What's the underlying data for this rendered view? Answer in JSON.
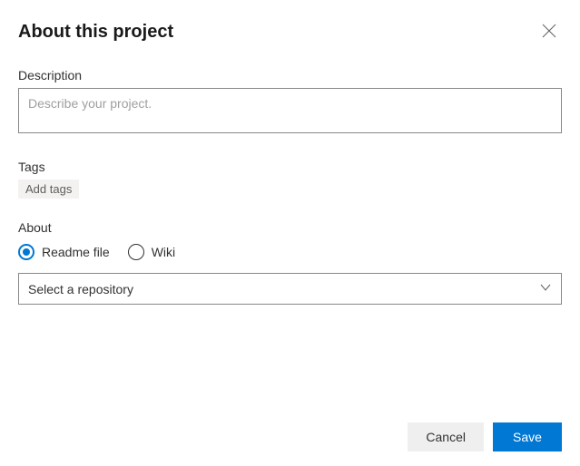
{
  "title": "About this project",
  "description": {
    "label": "Description",
    "placeholder": "Describe your project.",
    "value": ""
  },
  "tags": {
    "label": "Tags",
    "add_label": "Add tags"
  },
  "about": {
    "label": "About",
    "options": {
      "readme": {
        "label": "Readme file",
        "selected": true
      },
      "wiki": {
        "label": "Wiki",
        "selected": false
      }
    },
    "repository_select": {
      "placeholder": "Select a repository"
    }
  },
  "buttons": {
    "cancel": "Cancel",
    "save": "Save"
  }
}
